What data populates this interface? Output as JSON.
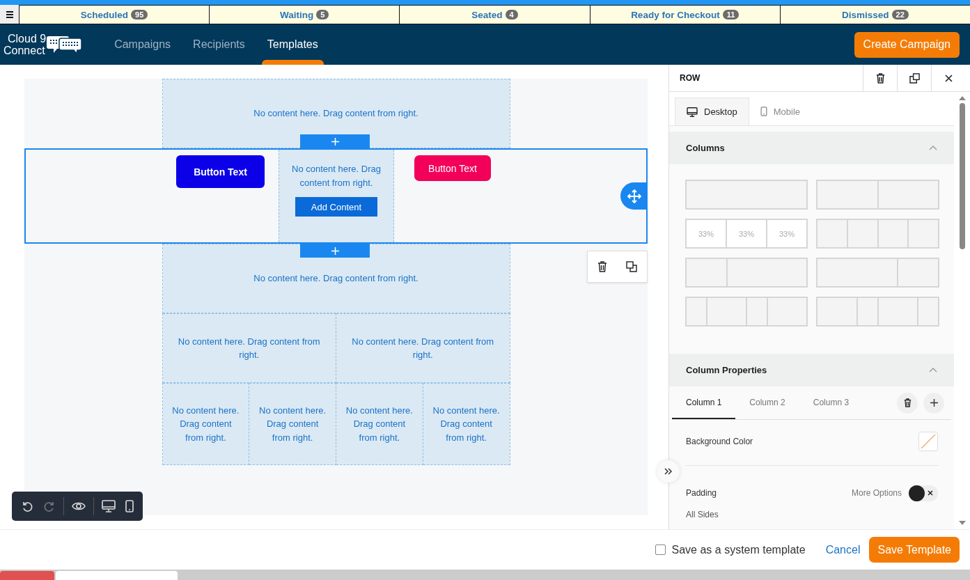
{
  "status_tabs": [
    {
      "label": "Scheduled",
      "count": "95"
    },
    {
      "label": "Waiting",
      "count": "5"
    },
    {
      "label": "Seated",
      "count": "4"
    },
    {
      "label": "Ready for Checkout",
      "count": "11"
    },
    {
      "label": "Dismissed",
      "count": "22"
    }
  ],
  "logo": {
    "line1": "Cloud 9",
    "line2": "Connect"
  },
  "nav": [
    {
      "label": "Campaigns",
      "selected": false
    },
    {
      "label": "Recipients",
      "selected": false
    },
    {
      "label": "Templates",
      "selected": true
    }
  ],
  "create_button": "Create Campaign",
  "canvas": {
    "rows": [
      {
        "kind": "placeholder",
        "columns": [
          {
            "kind": "empty",
            "text": "No content here. Drag content from right."
          }
        ]
      },
      {
        "kind": "content",
        "selected": true,
        "columns": [
          {
            "kind": "button",
            "text": "Button Text",
            "color": "#0b00e8"
          },
          {
            "kind": "empty",
            "text": "No content here. Drag content from right.",
            "action": "Add Content"
          },
          {
            "kind": "button",
            "text": "Button Text",
            "color": "#f2005a"
          }
        ]
      },
      {
        "kind": "placeholder",
        "columns": [
          {
            "kind": "empty",
            "text": "No content here. Drag content from right."
          }
        ]
      },
      {
        "kind": "placeholder",
        "columns": [
          {
            "kind": "empty",
            "text": "No content here. Drag content from right."
          },
          {
            "kind": "empty",
            "text": "No content here. Drag content from right."
          }
        ]
      },
      {
        "kind": "placeholder",
        "columns": [
          {
            "kind": "empty",
            "text": "No content here. Drag content from right."
          },
          {
            "kind": "empty",
            "text": "No content here. Drag content from right."
          },
          {
            "kind": "empty",
            "text": "No content here. Drag content from right."
          },
          {
            "kind": "empty",
            "text": "No content here. Drag content from right."
          }
        ]
      }
    ]
  },
  "toolbar": [
    {
      "kind": "undo",
      "disabled": false
    },
    {
      "kind": "redo",
      "disabled": true
    },
    {
      "kind": "preview",
      "disabled": false
    },
    {
      "kind": "desktop",
      "disabled": false
    },
    {
      "kind": "mobile",
      "disabled": false
    }
  ],
  "panel": {
    "title": "ROW",
    "view_tabs": [
      {
        "label": "Desktop",
        "kind": "desktop",
        "selected": true
      },
      {
        "label": "Mobile",
        "kind": "mobile",
        "selected": false
      }
    ],
    "columns_section": {
      "title": "Columns",
      "expanded": true,
      "presets": [
        {
          "selected": false
        },
        {
          "selected": false
        },
        {
          "selected": true,
          "labels": [
            "33%",
            "33%",
            "33%"
          ]
        },
        {
          "selected": false
        },
        {
          "selected": false
        },
        {
          "selected": false
        },
        {
          "selected": false
        },
        {
          "selected": false
        }
      ]
    },
    "properties_section": {
      "title": "Column Properties",
      "expanded": true,
      "column_tabs": [
        {
          "label": "Column 1",
          "selected": true
        },
        {
          "label": "Column 2",
          "selected": false
        },
        {
          "label": "Column 3",
          "selected": false
        }
      ],
      "background_label": "Background Color",
      "padding_label": "Padding",
      "more_options": "More Options",
      "more_options_on": false,
      "all_sides": "All Sides"
    }
  },
  "footer": {
    "system_template": {
      "label": "Save as a system template",
      "checked": false
    },
    "cancel": "Cancel",
    "save": "Save Template"
  }
}
